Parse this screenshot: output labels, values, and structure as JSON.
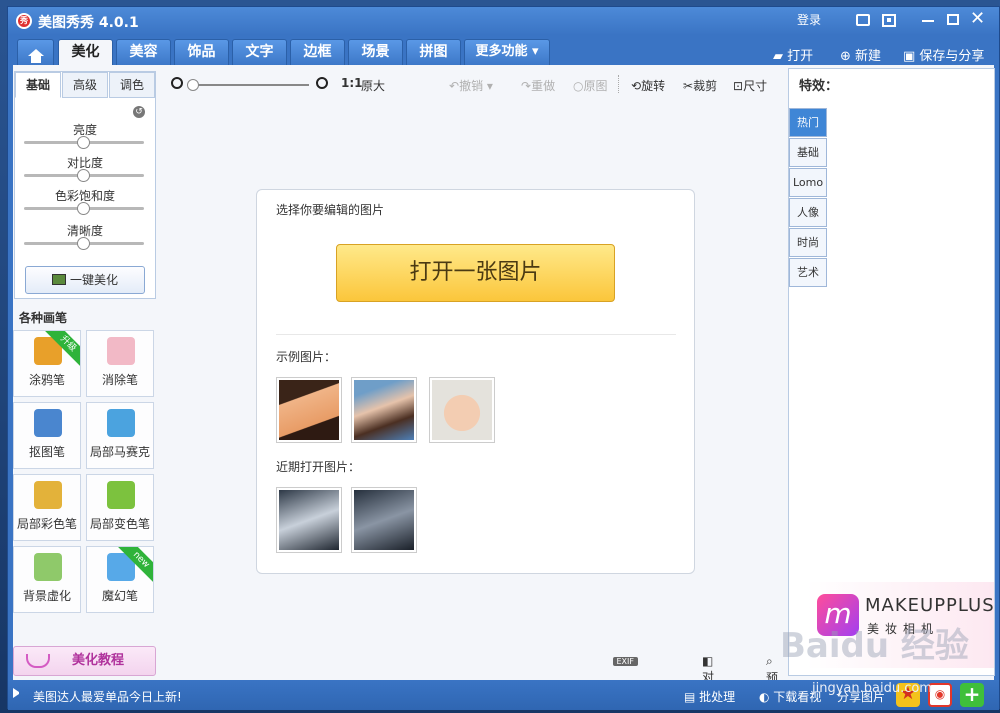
{
  "window": {
    "title": "美图秀秀 4.0.1",
    "logo_text": "秀",
    "login": "登录"
  },
  "tabs": [
    {
      "label": "美化"
    },
    {
      "label": "美容"
    },
    {
      "label": "饰品"
    },
    {
      "label": "文字"
    },
    {
      "label": "边框"
    },
    {
      "label": "场景"
    },
    {
      "label": "拼图"
    },
    {
      "label": "更多功能 ▾"
    }
  ],
  "actions": {
    "open": "打开",
    "new": "新建",
    "save": "保存与分享"
  },
  "adjust": {
    "tabs": [
      "基础",
      "高级",
      "调色"
    ],
    "sliders": [
      {
        "label": "亮度",
        "level": 0.5
      },
      {
        "label": "对比度",
        "level": 0.5
      },
      {
        "label": "色彩饱和度",
        "level": 0.5
      },
      {
        "label": "清晰度",
        "level": 0.5
      }
    ],
    "one_key": "一键美化"
  },
  "brushes": {
    "title": "各种画笔",
    "items": [
      {
        "label": "涂鸦笔",
        "ribbon": "升级",
        "icon": "pencil-icon",
        "color": "#e8a02a"
      },
      {
        "label": "消除笔",
        "ribbon": "",
        "icon": "eraser-icon",
        "color": "#f2b9c6"
      },
      {
        "label": "抠图笔",
        "ribbon": "",
        "icon": "cutout-pen-icon",
        "color": "#4a86cf"
      },
      {
        "label": "局部马赛克",
        "ribbon": "",
        "icon": "mosaic-icon",
        "color": "#4ba3df"
      },
      {
        "label": "局部彩色笔",
        "ribbon": "",
        "icon": "color-brush-icon",
        "color": "#e3b23a"
      },
      {
        "label": "局部变色笔",
        "ribbon": "",
        "icon": "paint-bucket-icon",
        "color": "#7cc23e"
      },
      {
        "label": "背景虚化",
        "ribbon": "",
        "icon": "blur-icon",
        "color": "#8fc96a"
      },
      {
        "label": "魔幻笔",
        "ribbon": "new",
        "icon": "magic-pen-icon",
        "color": "#57a9e8"
      }
    ],
    "tutorial": "美化教程"
  },
  "toolbar": {
    "ratio": "1:1",
    "orig_size": "原大",
    "undo": "撤销",
    "redo": "重做",
    "original": "原图",
    "rotate": "旋转",
    "crop": "裁剪",
    "size": "尺寸"
  },
  "card": {
    "choose": "选择你要编辑的图片",
    "open_button": "打开一张图片",
    "sample": "示例图片：",
    "recent": "近期打开图片："
  },
  "bottom_tools": {
    "exif": "EXIF",
    "compare": "对比",
    "preview": "预览"
  },
  "effects": {
    "title": "特效：",
    "tabs": [
      "热门",
      "基础",
      "Lomo",
      "人像",
      "时尚",
      "艺术"
    ]
  },
  "ad": {
    "logo": "m",
    "name": "MAKEUPPLUS",
    "sub": "美妆相机"
  },
  "status": {
    "news": "美图达人最爱单品今日上新!",
    "batch": "批处理",
    "download": "下载看视",
    "share": "分享图片"
  },
  "watermark": {
    "text": "Baidu 经验",
    "url": "jingyan.baidu.com"
  }
}
